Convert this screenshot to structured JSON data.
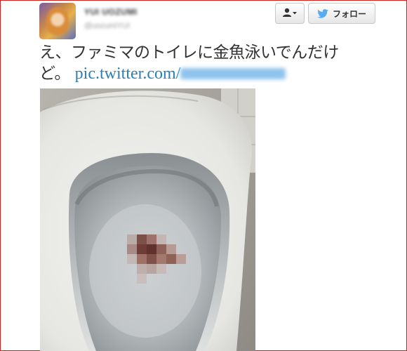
{
  "user": {
    "name": "YUI UOZUMI",
    "handle": "@uozumiYUI"
  },
  "buttons": {
    "user_menu_icon": "person-icon",
    "follow_label": "フォロー",
    "follow_icon": "twitter-bird-icon"
  },
  "tweet": {
    "text_line1": "え、ファミマのトイレに金魚泳いでんだけ",
    "text_line2": "ど。",
    "link_text": "pic.twitter.com/"
  },
  "colors": {
    "link": "#2a7fb8",
    "bird": "#55acee",
    "frame_border": "#cc2222"
  },
  "photo": {
    "subject_icon": "toilet-photo"
  }
}
